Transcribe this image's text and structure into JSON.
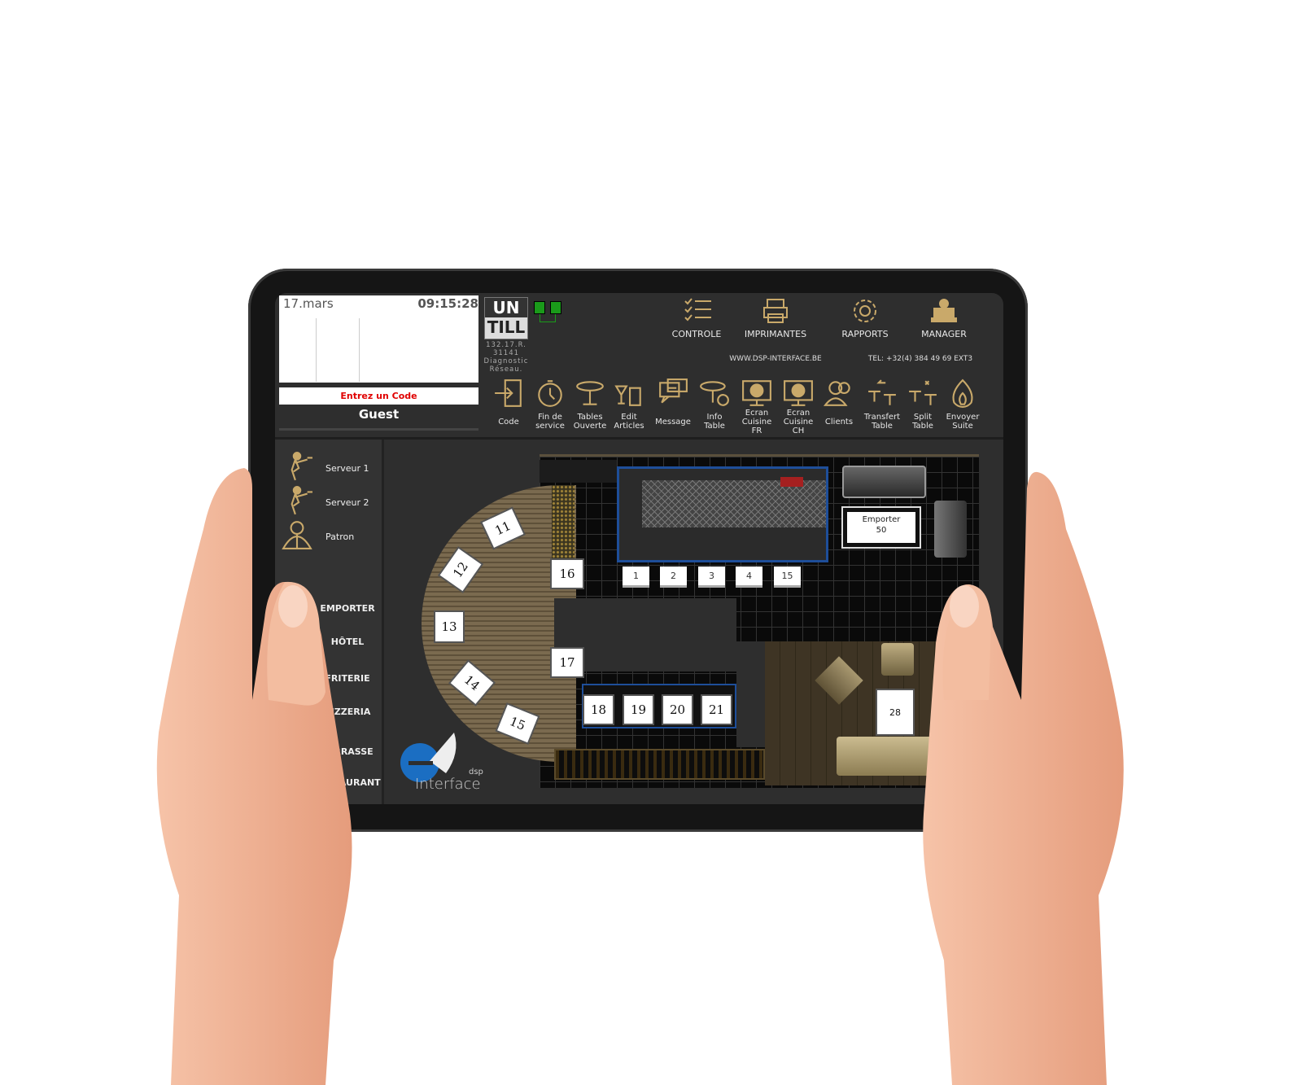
{
  "header": {
    "date": "17.mars",
    "time": "09:15:28",
    "code_prompt": "Entrez un Code",
    "user": "Guest",
    "logo_top": "UN",
    "logo_bottom": "TILL",
    "diagnostic": [
      "132.17.R.",
      "31141",
      "Diagnostic",
      "Réseau."
    ],
    "website": "WWW.DSP-INTERFACE.BE",
    "phone": "TEL: +32(4) 384 49 69 EXT3"
  },
  "top_menu": [
    {
      "label": "CONTROLE",
      "icon": "checklist-icon"
    },
    {
      "label": "IMPRIMANTES",
      "icon": "printer-icon"
    },
    {
      "label": "RAPPORTS",
      "icon": "gear-icon"
    },
    {
      "label": "MANAGER",
      "icon": "manager-icon"
    }
  ],
  "toolbar": [
    {
      "label": "Code",
      "icon": "login-icon"
    },
    {
      "label": "Fin de\nservice",
      "icon": "stopwatch-icon"
    },
    {
      "label": "Tables\nOuverte",
      "icon": "table-icon"
    },
    {
      "label": "Edit\nArticles",
      "icon": "drinks-icon"
    },
    {
      "label": "Message",
      "icon": "message-icon"
    },
    {
      "label": "Info\nTable",
      "icon": "table-info-icon"
    },
    {
      "label": "Ecran\nCuisine FR",
      "icon": "kitchen-screen-snow-icon"
    },
    {
      "label": "Ecran\nCuisine CH",
      "icon": "kitchen-screen-fire-icon"
    },
    {
      "label": "Clients",
      "icon": "clients-icon"
    },
    {
      "label": "Transfert\nTable",
      "icon": "transfer-table-icon"
    },
    {
      "label": "Split\nTable",
      "icon": "split-table-icon"
    },
    {
      "label": "Envoyer\nSuite",
      "icon": "fire-icon"
    }
  ],
  "staff": [
    {
      "label": "Serveur 1",
      "icon": "waiter-icon"
    },
    {
      "label": "Serveur 2",
      "icon": "waiter-icon"
    },
    {
      "label": "Patron",
      "icon": "boss-icon"
    }
  ],
  "sections": [
    "EMPORTER",
    "HÔTEL",
    "FRITERIE",
    "PIZZERIA",
    "TERRASSE",
    "RESTAURANT"
  ],
  "tables": [
    "11",
    "12",
    "13",
    "14",
    "15",
    "16",
    "17",
    "1",
    "2",
    "3",
    "4",
    "15",
    "18",
    "19",
    "20",
    "21",
    "28"
  ],
  "takeaway": {
    "label": "Emporter",
    "count": "50"
  },
  "brand": {
    "dsp": "dsp",
    "name": "Interface"
  },
  "colors": {
    "accent": "#c9a96a",
    "prompt": "#e00000",
    "status_ok": "#1a9a1a"
  }
}
